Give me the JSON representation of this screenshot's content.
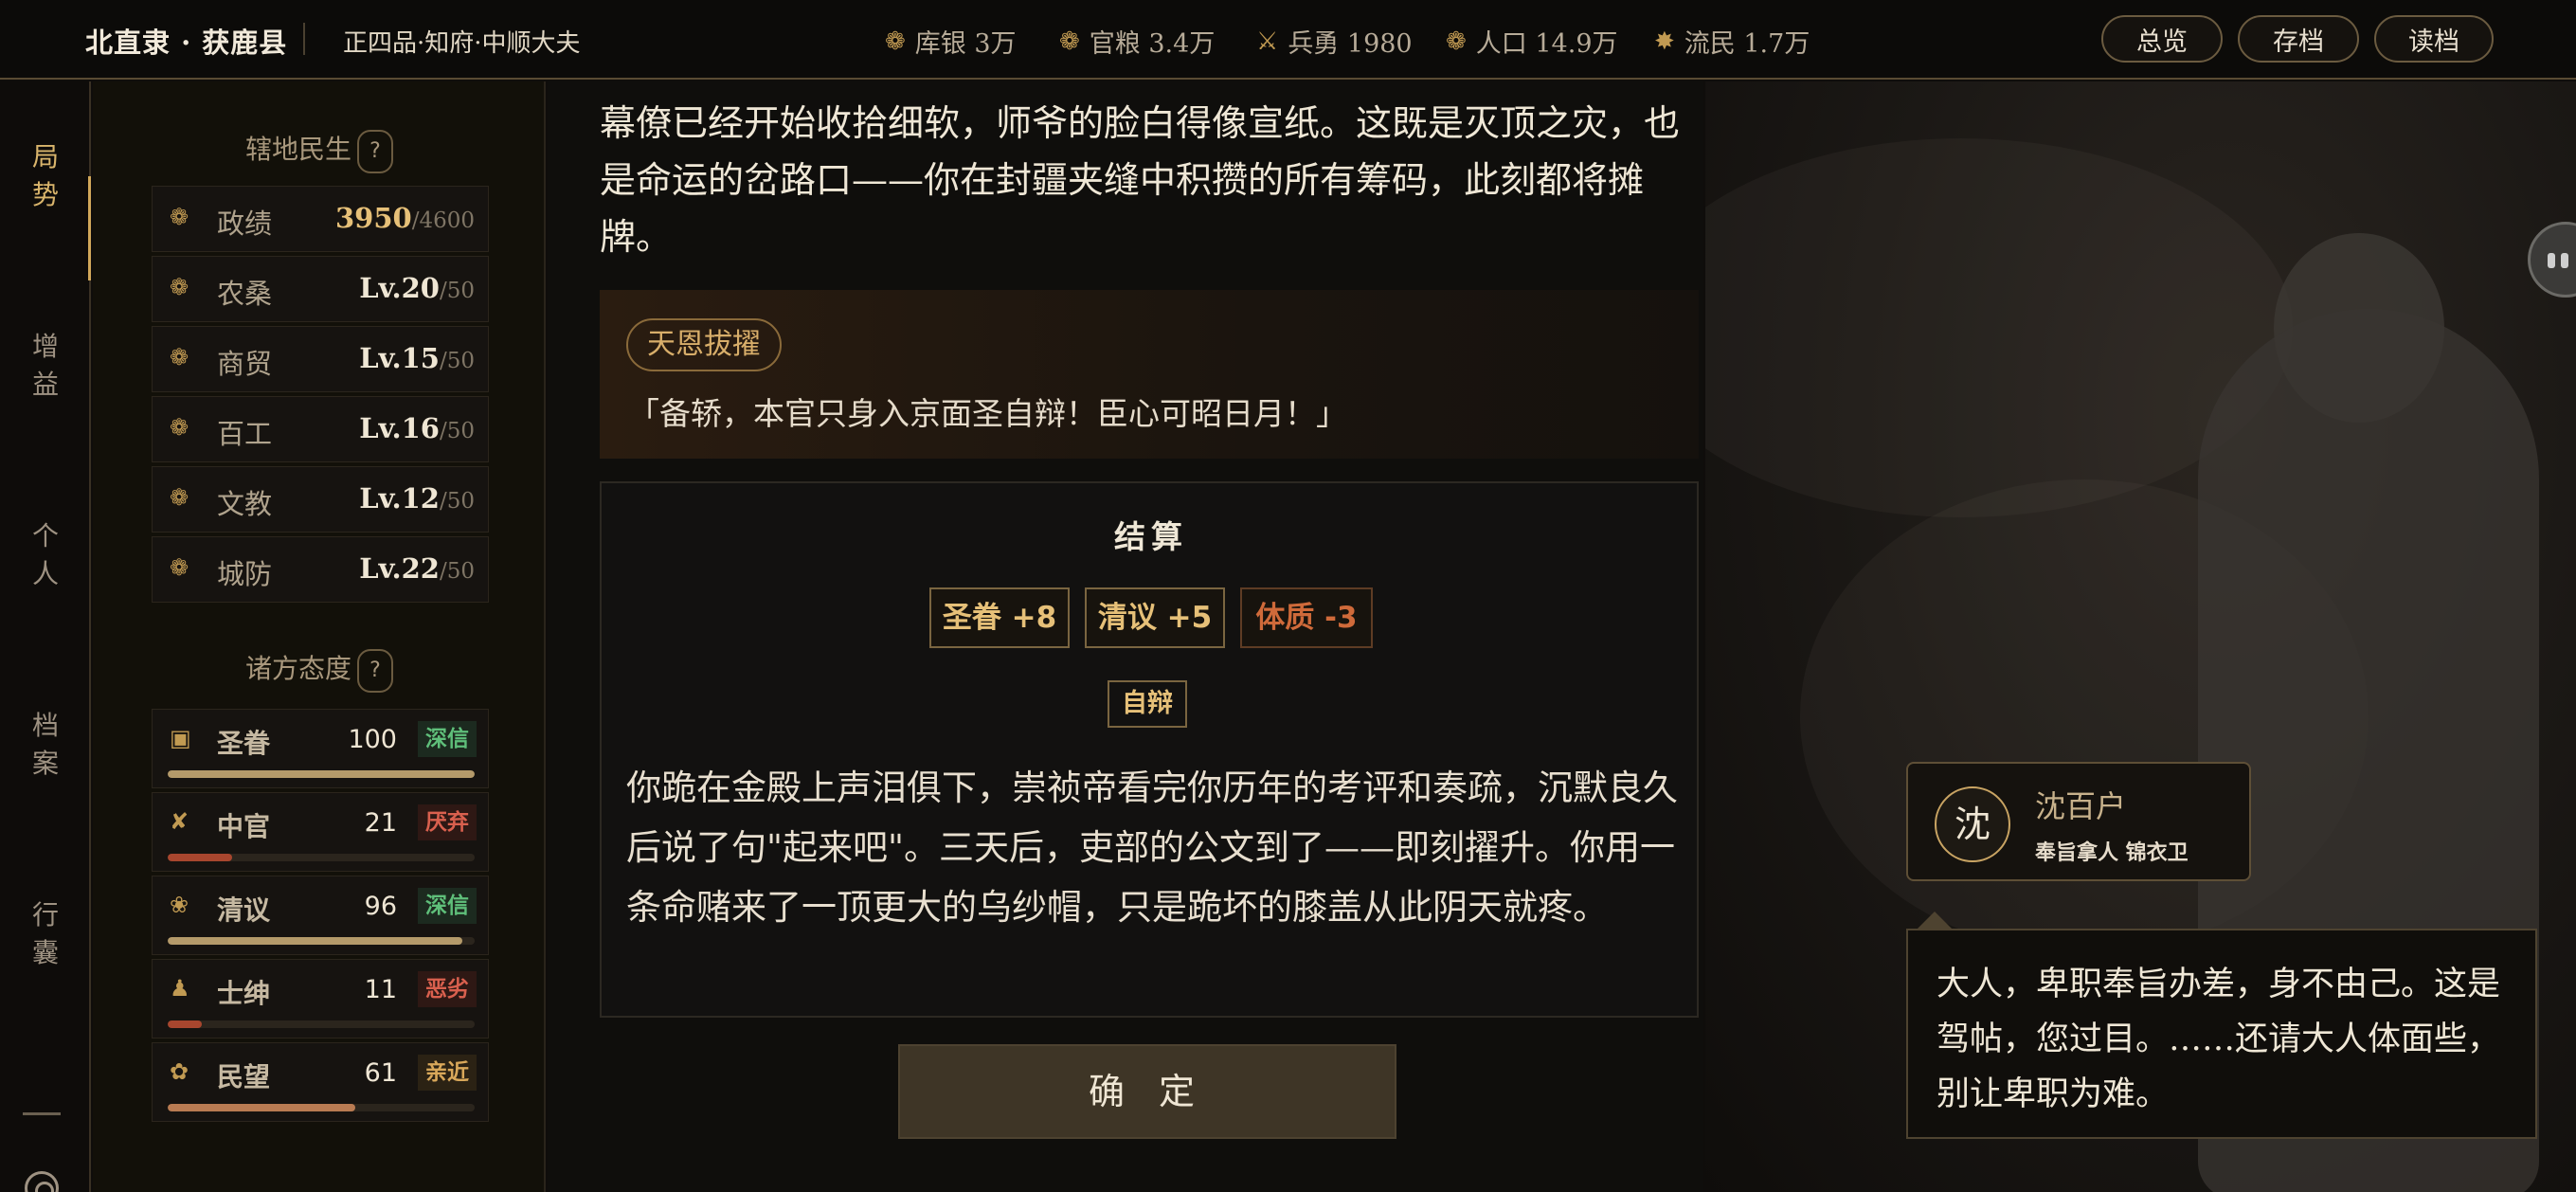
{
  "topbar": {
    "location": "北直隶 · 获鹿县",
    "rank": "正四品·知府·中顺大夫",
    "resources": [
      {
        "icon": "silver-icon",
        "glyph": "❁",
        "text": "库银 3万"
      },
      {
        "icon": "grain-icon",
        "glyph": "❁",
        "text": "官粮 3.4万"
      },
      {
        "icon": "soldier-icon",
        "glyph": "⚔",
        "text": "兵勇 1980"
      },
      {
        "icon": "population-icon",
        "glyph": "❁",
        "text": "人口 14.9万"
      },
      {
        "icon": "refugee-icon",
        "glyph": "✸",
        "text": "流民 1.7万"
      }
    ],
    "buttons": {
      "overview": "总览",
      "save": "存档",
      "load": "读档"
    }
  },
  "rail": {
    "items": [
      {
        "label": "局\n势",
        "active": true
      },
      {
        "label": "增\n益"
      },
      {
        "label": "个\n人"
      },
      {
        "label": "档\n案"
      },
      {
        "label": "行\n囊"
      }
    ]
  },
  "domain": {
    "title": "辖地民生",
    "help": "?",
    "rows": [
      {
        "label": "政绩",
        "value": "3950",
        "max": "/4600",
        "icon": "merit-icon"
      },
      {
        "label": "农桑",
        "value": "Lv.20",
        "max": "/50",
        "icon": "farm-icon"
      },
      {
        "label": "商贸",
        "value": "Lv.15",
        "max": "/50",
        "icon": "trade-icon"
      },
      {
        "label": "百工",
        "value": "Lv.16",
        "max": "/50",
        "icon": "craft-icon"
      },
      {
        "label": "文教",
        "value": "Lv.12",
        "max": "/50",
        "icon": "education-icon"
      },
      {
        "label": "城防",
        "value": "Lv.22",
        "max": "/50",
        "icon": "defense-icon"
      }
    ]
  },
  "factions": {
    "title": "诸方态度",
    "help": "?",
    "rows": [
      {
        "label": "圣眷",
        "value": "100",
        "tag": "深信",
        "fill": 1.0,
        "tag_color": "#5fbf7a",
        "tag_bg": "#1c2a1f",
        "bar_color": "#b49a6a",
        "icon": "emperor-icon"
      },
      {
        "label": "中官",
        "value": "21",
        "tag": "厌弃",
        "fill": 0.21,
        "tag_color": "#d9604e",
        "tag_bg": "#2e1814",
        "bar_color": "#a8462e",
        "icon": "eunuch-icon"
      },
      {
        "label": "清议",
        "value": "96",
        "tag": "深信",
        "fill": 0.96,
        "tag_color": "#5fbf7a",
        "tag_bg": "#1c2a1f",
        "bar_color": "#b49a6a",
        "icon": "scholar-icon"
      },
      {
        "label": "士绅",
        "value": "11",
        "tag": "恶劣",
        "fill": 0.11,
        "tag_color": "#d9604e",
        "tag_bg": "#2e1814",
        "bar_color": "#a8462e",
        "icon": "gentry-icon"
      },
      {
        "label": "民望",
        "value": "61",
        "tag": "亲近",
        "fill": 0.61,
        "tag_color": "#d9a85a",
        "tag_bg": "#2b2214",
        "bar_color": "#b97b52",
        "icon": "people-icon"
      }
    ]
  },
  "story": {
    "narration": "幕僚已经开始收拾细软，师爷的脸白得像宣纸。这既是灭顶之灾，也是命运的岔路口——你在封疆夹缝中积攒的所有筹码，此刻都将摊牌。",
    "choice_tag": "天恩拔擢",
    "quote": "「备轿，本官只身入京面圣自辩！臣心可昭日月！」"
  },
  "result": {
    "title": "结算",
    "effects": [
      {
        "text": "圣眷 +8",
        "negative": false
      },
      {
        "text": "清议 +5",
        "negative": false
      },
      {
        "text": "体质 -3",
        "negative": true
      }
    ],
    "choice": "自辩",
    "body": "你跪在金殿上声泪俱下，崇祯帝看完你历年的考评和奏疏，沉默良久后说了句\"起来吧\"。三天后，吏部的公文到了——即刻擢升。你用一条命赌来了一顶更大的乌纱帽，只是跪坏的膝盖从此阴天就疼。",
    "confirm": "确 定"
  },
  "npc": {
    "avatar": "沈",
    "name": "沈百户",
    "role": "奉旨拿人  锦衣卫",
    "dialog": "大人，卑职奉旨办差，身不由己。这是驾帖，您过目。……还请大人体面些，别让卑职为难。"
  }
}
